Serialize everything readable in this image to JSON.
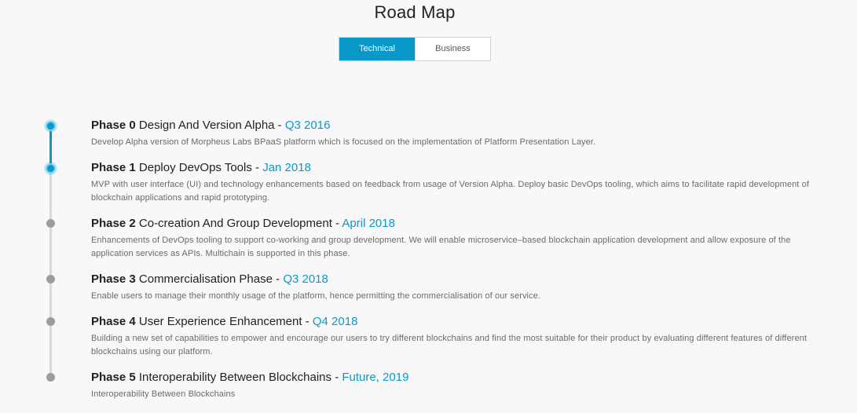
{
  "page": {
    "title": "Road Map"
  },
  "tabs": [
    {
      "label": "Technical",
      "active": true
    },
    {
      "label": "Business",
      "active": false
    }
  ],
  "colors": {
    "accent": "#0a98c9",
    "inactive_dot": "#9c9c9c",
    "rail_inactive": "#d9d9d9"
  },
  "phases": [
    {
      "label": "Phase 0",
      "name": "Design And Version Alpha",
      "sep": " - ",
      "date": "Q3 2016",
      "completed": true,
      "desc": "Develop Alpha version of Morpheus Labs BPaaS platform which is focused on the implementation of Platform Presentation Layer."
    },
    {
      "label": "Phase 1",
      "name": "Deploy DevOps Tools",
      "sep": " - ",
      "date": "Jan 2018",
      "completed": true,
      "desc": "MVP with user interface (UI) and technology enhancements based on feedback from usage of Version Alpha. Deploy basic DevOps tooling, which aims to facilitate rapid development of blockchain applications and rapid prototyping."
    },
    {
      "label": "Phase 2",
      "name": "Co-creation And Group Development",
      "sep": " - ",
      "date": "April 2018",
      "completed": false,
      "desc": "Enhancements of DevOps tooling to support co-working and group development. We will enable microservice–based blockchain application development and allow exposure of the application services as APIs. Multichain is supported in this phase."
    },
    {
      "label": "Phase 3",
      "name": "Commercialisation Phase",
      "sep": " - ",
      "date": "Q3 2018",
      "completed": false,
      "desc": "Enable users to manage their monthly usage of the platform, hence permitting the commercialisation of our service."
    },
    {
      "label": "Phase 4",
      "name": "User Experience Enhancement",
      "sep": " - ",
      "date": "Q4 2018",
      "completed": false,
      "desc": "Building a new set of capabilities to empower and encourage our users to try different blockchains and find the most suitable for their product by evaluating different features of different blockchains using our platform."
    },
    {
      "label": "Phase 5",
      "name": "Interoperability Between Blockchains",
      "sep": " - ",
      "date": "Future, 2019",
      "completed": false,
      "desc": "Interoperability Between Blockchains"
    }
  ]
}
